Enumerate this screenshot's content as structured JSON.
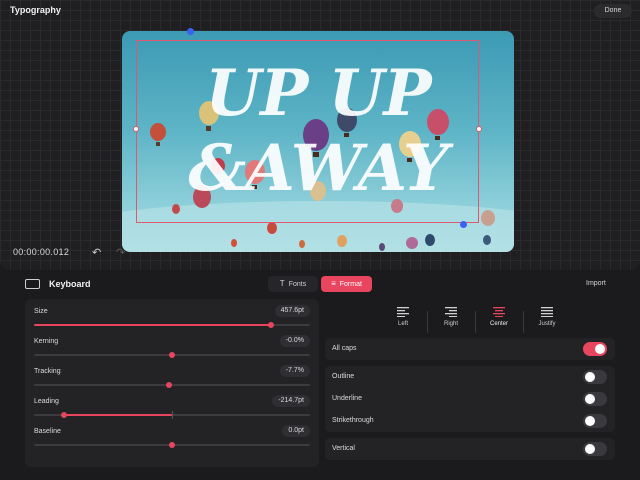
{
  "header": {
    "title": "Typography",
    "done_label": "Done"
  },
  "canvas": {
    "headline_line1": "UP UP",
    "headline_line2": "&AWAY",
    "timecode": "00:00:00.012"
  },
  "toolbar": {
    "keyboard_label": "Keyboard",
    "tabs": [
      {
        "label": "Fonts",
        "icon": "text-icon",
        "active": false
      },
      {
        "label": "Format",
        "icon": "align-center-icon",
        "active": true
      }
    ],
    "import_label": "Import"
  },
  "sliders": [
    {
      "label": "Size",
      "value": "457.6pt",
      "level": 0.86
    },
    {
      "label": "Kerning",
      "value": "-0.0%",
      "level": 0.5
    },
    {
      "label": "Tracking",
      "value": "-7.7%",
      "level": 0.49
    },
    {
      "label": "Leading",
      "value": "-214.7pt",
      "level": 0.11
    },
    {
      "label": "Baseline",
      "value": "0.0pt",
      "level": 0.5
    }
  ],
  "alignment": {
    "options": [
      "Left",
      "Right",
      "Center",
      "Justify"
    ],
    "selected": "Center"
  },
  "options": [
    {
      "label": "All caps",
      "on": true
    },
    {
      "label": "Outline",
      "on": false
    },
    {
      "label": "Underline",
      "on": false
    },
    {
      "label": "Strikethrough",
      "on": false
    },
    {
      "label": "Vertical",
      "on": false
    }
  ],
  "colors": {
    "accent": "#e8455f",
    "selection_handle": "#3b62f0"
  }
}
